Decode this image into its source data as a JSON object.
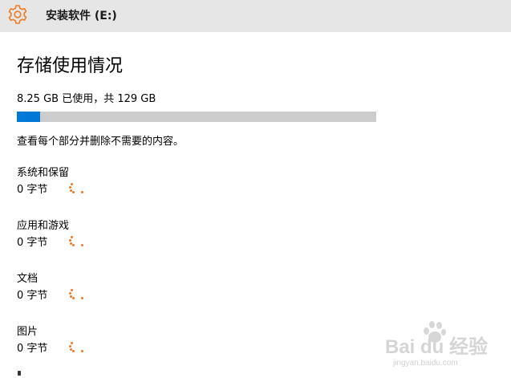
{
  "window": {
    "title": "安装软件 (E:)",
    "icon": "gear-icon",
    "accent_color": "#f07a22"
  },
  "page": {
    "title": "存储使用情况",
    "usage_text": "8.25 GB 已使用，共 129 GB",
    "usage_fraction": 0.064,
    "intro": "查看每个部分并删除不需要的内容。"
  },
  "categories": [
    {
      "name": "系统和保留",
      "size": "0 字节"
    },
    {
      "name": "应用和游戏",
      "size": "0 字节"
    },
    {
      "name": "文档",
      "size": "0 字节"
    },
    {
      "name": "图片",
      "size": "0 字节"
    }
  ],
  "watermark": {
    "brand": "Bai du 经验",
    "url": "jingyan.baidu.com"
  }
}
